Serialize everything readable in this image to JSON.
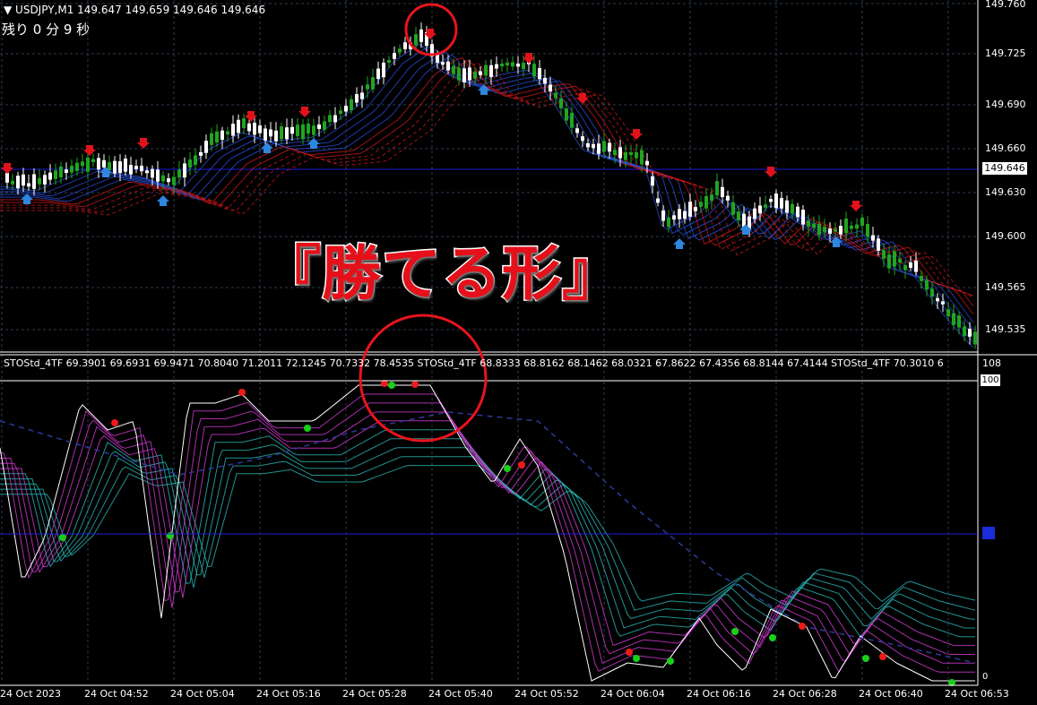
{
  "header": {
    "symbol_line": "▼ USDJPY,M1  149.647 149.659 149.646 149.646",
    "countdown": "残り 0 分 9 秒"
  },
  "overlay_title": "『勝てる形』",
  "price_axis": {
    "labels": [
      "149.760",
      "149.725",
      "149.690",
      "149.660",
      "149.630",
      "149.600",
      "149.565",
      "149.535"
    ],
    "current_price": "149.646"
  },
  "indicator": {
    "label": "STOStd_4TF 69.3901 69.6931 69.9471 70.8040 71.2011 72.1245 70.7332 78.4535  STOStd_4TF 68.8333 68.8162 68.1462 68.0321 67.8622 67.4356 68.8144 67.4144  STOStd_4TF 70.3010 6",
    "scale_max": "108",
    "level_box": "100",
    "bottom_label": "0"
  },
  "time_axis": {
    "labels": [
      "24 Oct 2023",
      "24 Oct 04:52",
      "24 Oct 05:04",
      "24 Oct 05:16",
      "24 Oct 05:28",
      "24 Oct 05:40",
      "24 Oct 05:52",
      "24 Oct 06:04",
      "24 Oct 06:16",
      "24 Oct 06:28",
      "24 Oct 06:40",
      "24 Oct 06:53"
    ]
  },
  "colors": {
    "background": "#000000",
    "grid": "#2c3a4f",
    "bull_candle": "#1fa51f",
    "bear_candle": "#ffffff",
    "up_arrow": "#2e86de",
    "down_arrow": "#e0131b",
    "ribbon_red": "#d61818",
    "ribbon_blue": "#2a52e0",
    "stoch_magenta": "#d63bd6",
    "stoch_cyan": "#29b7b7",
    "dot_green": "#18d018",
    "dot_red": "#ee1a1a",
    "highlight_circle": "#e8141c",
    "midline": "#1c1cd8"
  }
}
